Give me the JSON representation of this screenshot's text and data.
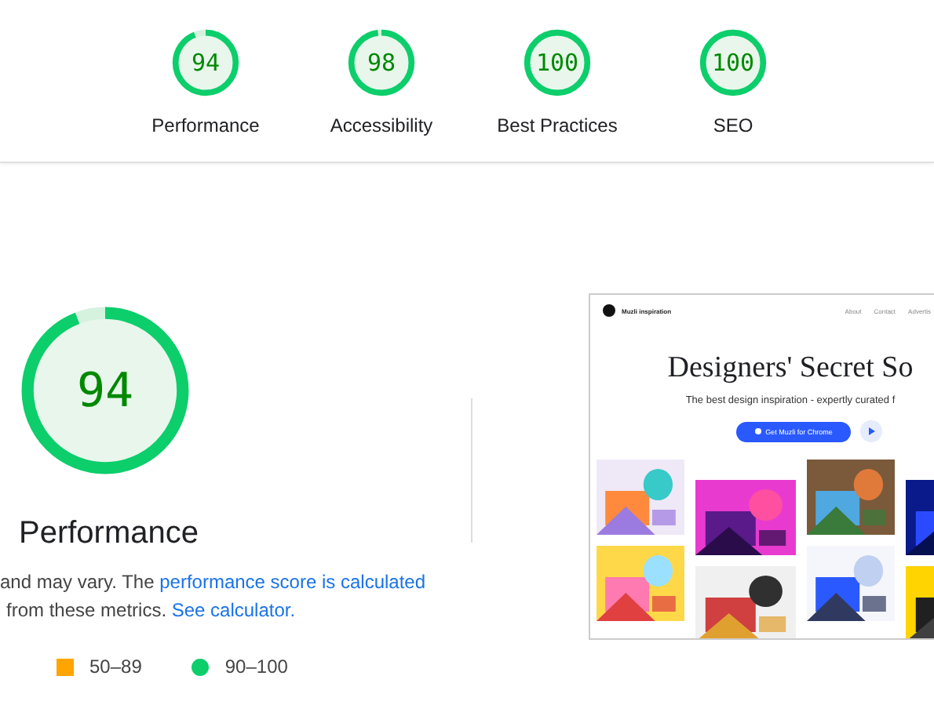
{
  "categories": [
    {
      "score": "94",
      "level": 0.94,
      "label": "Performance"
    },
    {
      "score": "98",
      "level": 0.98,
      "label": "Accessibility"
    },
    {
      "score": "100",
      "level": 1,
      "label": "Best Practices"
    },
    {
      "score": "100",
      "level": 1,
      "label": "SEO"
    }
  ],
  "main_gauge": {
    "score": "94",
    "level": 0.94,
    "label": "Performance"
  },
  "description": [
    {
      "text": "and may vary. The ",
      "link": "performance score is calculated"
    },
    {
      "text": "from these metrics. ",
      "link": "See calculator."
    }
  ],
  "legend": [
    {
      "kind": "square",
      "color": "#ffa400",
      "label": "50–89"
    },
    {
      "kind": "circle",
      "color": "#0cce6b",
      "label": "90–100"
    }
  ],
  "screenshot": {
    "brand": "Muzli inspiration",
    "nav": [
      "About",
      "Contact",
      "Advertis"
    ],
    "headline": "Designers' Secret So",
    "subtitle": "The best design inspiration - expertly curated f",
    "button": "Get Muzli for Chrome",
    "tiles": [
      {
        "kind": "picture"
      },
      {
        "kind": "picture"
      },
      {
        "kind": "picture"
      },
      {
        "kind": "picture"
      },
      {
        "kind": "picture"
      },
      {
        "kind": "picture"
      },
      {
        "kind": "picture"
      },
      {
        "kind": "picture"
      }
    ]
  }
}
